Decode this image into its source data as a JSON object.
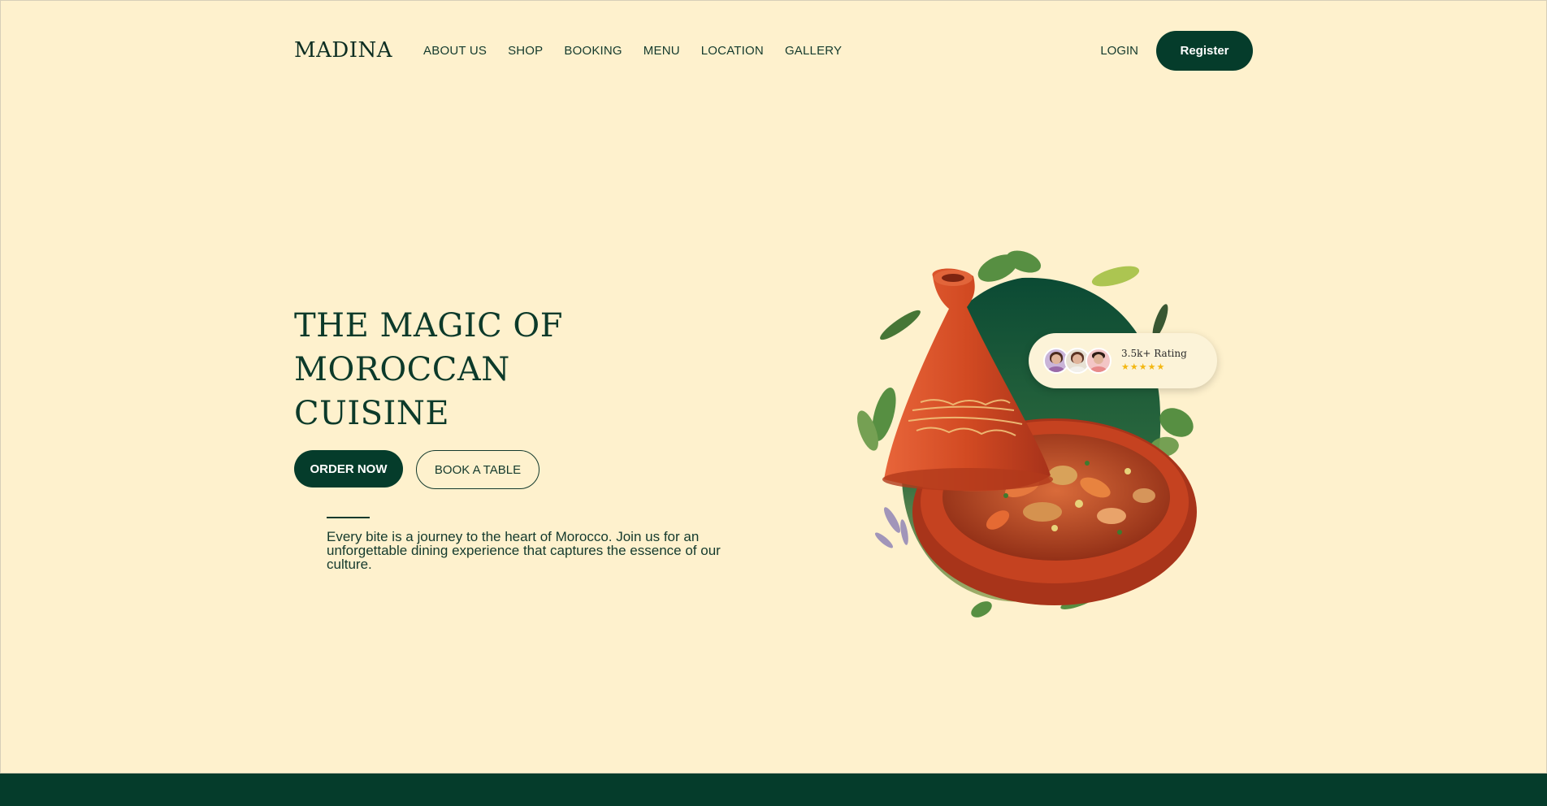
{
  "nav": {
    "logo": "MADINA",
    "links": [
      "ABOUT US",
      "SHOP",
      "BOOKING",
      "MENU",
      "LOCATION",
      "GALLERY"
    ],
    "login": "LOGIN",
    "register": "Register"
  },
  "hero": {
    "title_lines": [
      "THE MAGIC OF",
      "MOROCCAN",
      "CUISINE"
    ],
    "order_label": "ORDER NOW",
    "book_label": "BOOK A TABLE",
    "tagline": "Every bite is a journey to the heart of Morocco. Join us for an unforgettable dining experience that captures the essence of our culture."
  },
  "rating": {
    "label": "3.5k+ Rating",
    "stars": "★★★★★",
    "avatar_icons": [
      "woman-avatar",
      "woman-avatar",
      "man-avatar"
    ]
  },
  "colors": {
    "background": "#fef1cd",
    "primary": "#053c2b",
    "tagine": "#c8441f",
    "star": "#f3b712"
  }
}
